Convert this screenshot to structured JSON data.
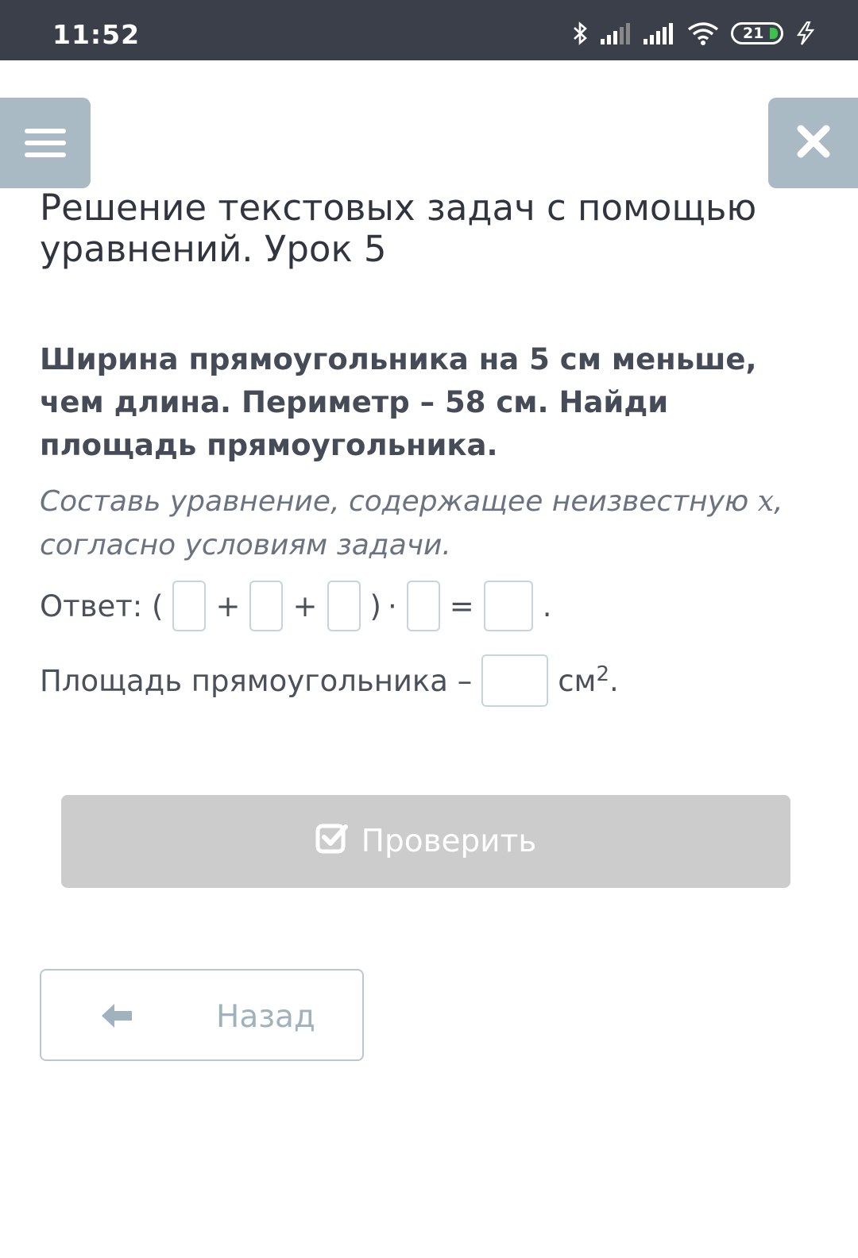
{
  "status_bar": {
    "time": "11:52",
    "battery_level": "21",
    "icons": [
      "bluetooth-icon",
      "signal-icon",
      "signal-icon",
      "wifi-icon",
      "battery-icon",
      "charging-icon"
    ]
  },
  "header": {
    "menu_icon": "menu-icon",
    "close_icon": "close-icon"
  },
  "lesson": {
    "title": "Решение текстовых задач с помощью уравнений. Урок 5",
    "task": "Ширина прямоугольника на 5 см меньше, чем длина. Периметр – 58 см. Найди площадь прямоугольника.",
    "hint_before": "Составь уравнение, содержащее неизвестную ",
    "hint_var": "x",
    "hint_after": ", согласно условиям задачи."
  },
  "answer": {
    "label": "Ответ: (",
    "plus1": "+",
    "plus2": "+",
    "close_paren": ")",
    "times": "·",
    "equals": "=",
    "period": ".",
    "inputs": [
      "",
      "",
      "",
      "",
      ""
    ]
  },
  "area": {
    "label": "Площадь прямоугольника –",
    "unit": "см",
    "power": "2",
    "period": ".",
    "input": ""
  },
  "buttons": {
    "check_label": "Проверить",
    "back_label": "Назад"
  },
  "colors": {
    "status_bar": "#3b3f4a",
    "nav_button": "#a9bac5",
    "check_disabled": "#cccccc",
    "back_text": "#9fb2be"
  }
}
